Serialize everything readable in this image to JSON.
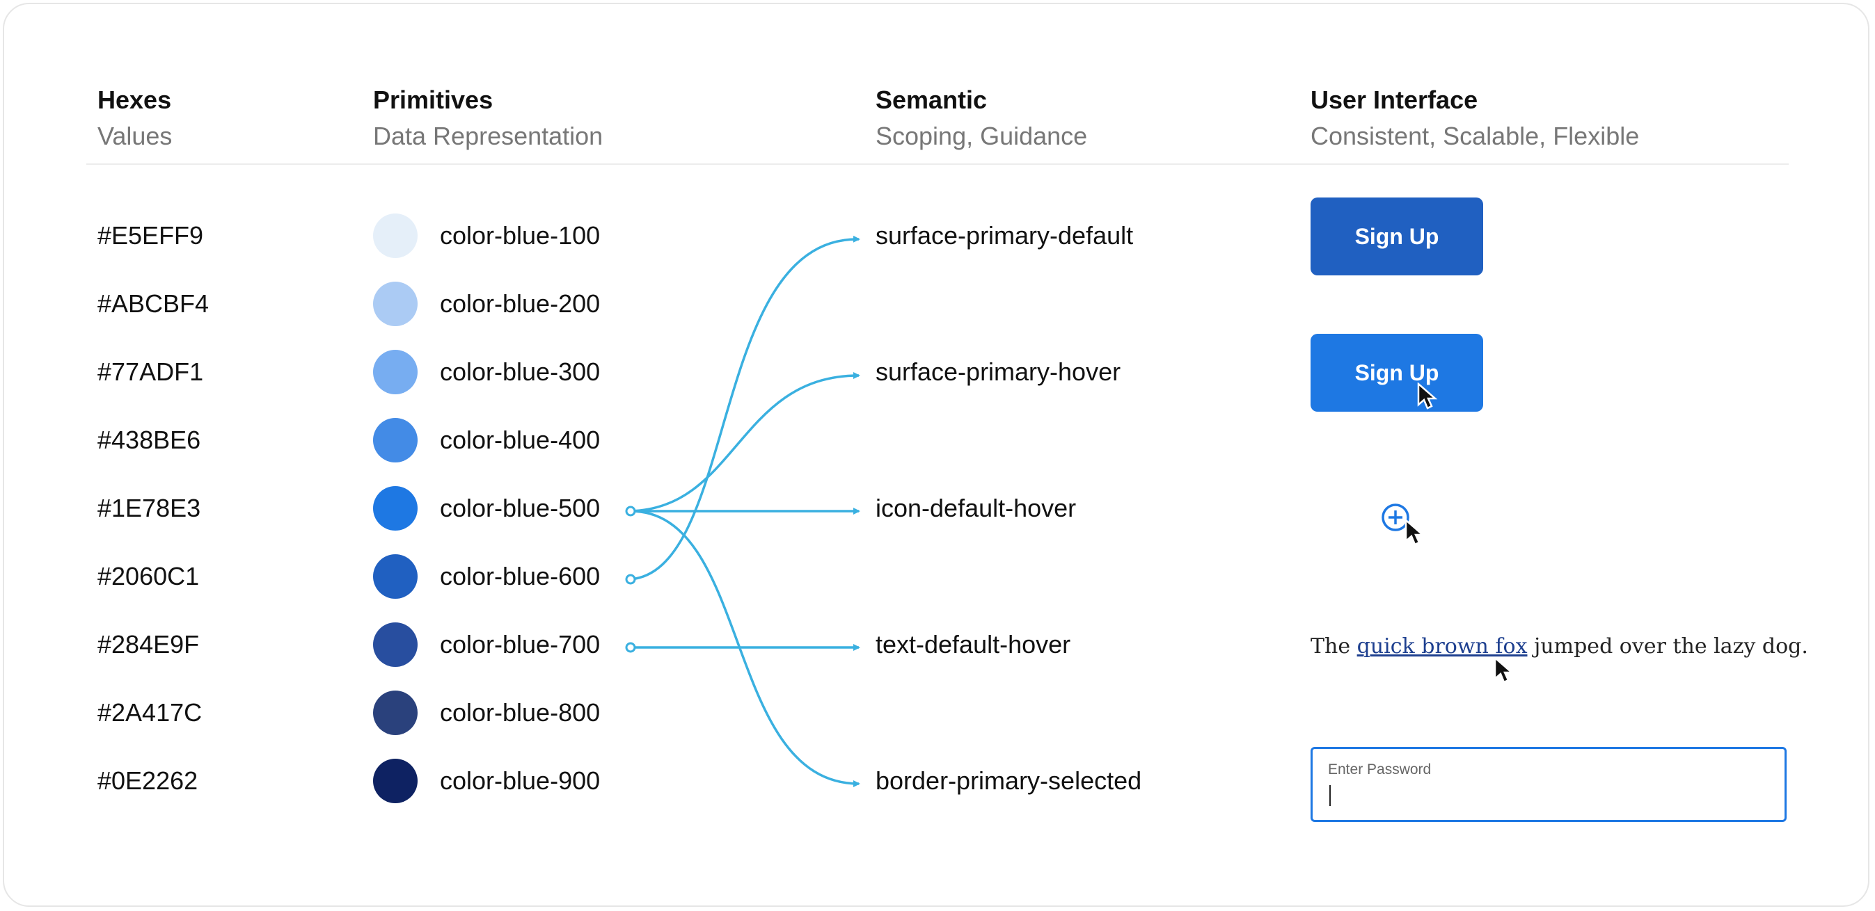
{
  "headers": [
    {
      "title": "Hexes",
      "subtitle": "Values"
    },
    {
      "title": "Primitives",
      "subtitle": "Data Representation"
    },
    {
      "title": "Semantic",
      "subtitle": "Scoping, Guidance"
    },
    {
      "title": "User Interface",
      "subtitle": "Consistent, Scalable, Flexible"
    }
  ],
  "rows": [
    {
      "hex": "#E5EFF9",
      "primitive": "color-blue-100",
      "color": "#E5EFF9"
    },
    {
      "hex": "#ABCBF4",
      "primitive": "color-blue-200",
      "color": "#ABCBF4"
    },
    {
      "hex": "#77ADF1",
      "primitive": "color-blue-300",
      "color": "#77ADF1"
    },
    {
      "hex": "#438BE6",
      "primitive": "color-blue-400",
      "color": "#438BE6"
    },
    {
      "hex": "#1E78E3",
      "primitive": "color-blue-500",
      "color": "#1E78E3"
    },
    {
      "hex": "#2060C1",
      "primitive": "color-blue-600",
      "color": "#2060C1"
    },
    {
      "hex": "#284E9F",
      "primitive": "color-blue-700",
      "color": "#284E9F"
    },
    {
      "hex": "#2A417C",
      "primitive": "color-blue-800",
      "color": "#2A417C"
    },
    {
      "hex": "#0E2262",
      "primitive": "color-blue-900",
      "color": "#0E2262"
    }
  ],
  "semantic": [
    "surface-primary-default",
    "surface-primary-hover",
    "icon-default-hover",
    "text-default-hover",
    "border-primary-selected"
  ],
  "connections": [
    {
      "from": "color-blue-600",
      "to": "surface-primary-default"
    },
    {
      "from": "color-blue-500",
      "to": "surface-primary-hover"
    },
    {
      "from": "color-blue-500",
      "to": "icon-default-hover"
    },
    {
      "from": "color-blue-700",
      "to": "text-default-hover"
    },
    {
      "from": "color-blue-500",
      "to": "border-primary-selected"
    }
  ],
  "ui": {
    "signup_default_label": "Sign Up",
    "signup_hover_label": "Sign Up",
    "signup_default_color": "#2060C1",
    "signup_hover_color": "#1E78E3",
    "icon_name": "plus-circle-icon",
    "sentence_before": "The ",
    "sentence_link": "quick brown fox",
    "sentence_after": " jumped over the lazy dog.",
    "password_placeholder": "Enter Password"
  },
  "link_color": "#3ab0e0"
}
